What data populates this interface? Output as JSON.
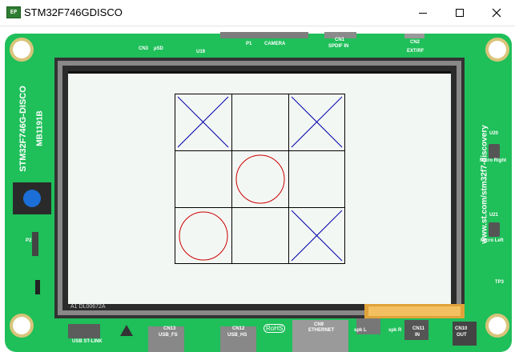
{
  "window": {
    "title": "STM32F746GDISCO",
    "icon_name": "stm32-app-icon",
    "controls": {
      "minimize": "minimize-icon",
      "maximize": "maximize-icon",
      "close": "close-icon"
    }
  },
  "board": {
    "pcb_color": "#1fbf5a",
    "labels": {
      "board_name": "STM32F746G-DISCO",
      "board_id": "MB1191B",
      "url": "www.st.com/stm32f7-discovery",
      "cn3": "CN3",
      "usd": "µSD",
      "u19": "U19",
      "p1": "P1",
      "camera": "CAMERA",
      "cn1": "CN1",
      "spdif": "SPDIF IN",
      "cn2": "CN2",
      "ext_rf": "EXT/RF",
      "u20": "U20",
      "micro_right": "Micro Right",
      "u21": "U21",
      "micro_left": "Micro Left",
      "tp3": "TP3",
      "lcd_part": "A1 DL00672A",
      "usb_stlink": "USB ST-LINK",
      "cn13": "CN13",
      "usb_fs": "USB_FS",
      "cn12": "CN12",
      "usb_hs": "USB_HS",
      "rohs": "RoHS",
      "cn9": "CN9",
      "ethernet": "ETHERNET",
      "spk_l": "spk L",
      "spk_r": "spk R",
      "cn11": "CN11",
      "in": "IN",
      "cn10": "CN10",
      "out": "OUT",
      "p2": "P2"
    }
  },
  "game": {
    "cells": [
      "X",
      "",
      "X",
      "",
      "O",
      "",
      "O",
      "",
      "X"
    ],
    "x_color": "#0000aa",
    "o_color": "#cc0000",
    "grid_color": "#000000"
  }
}
